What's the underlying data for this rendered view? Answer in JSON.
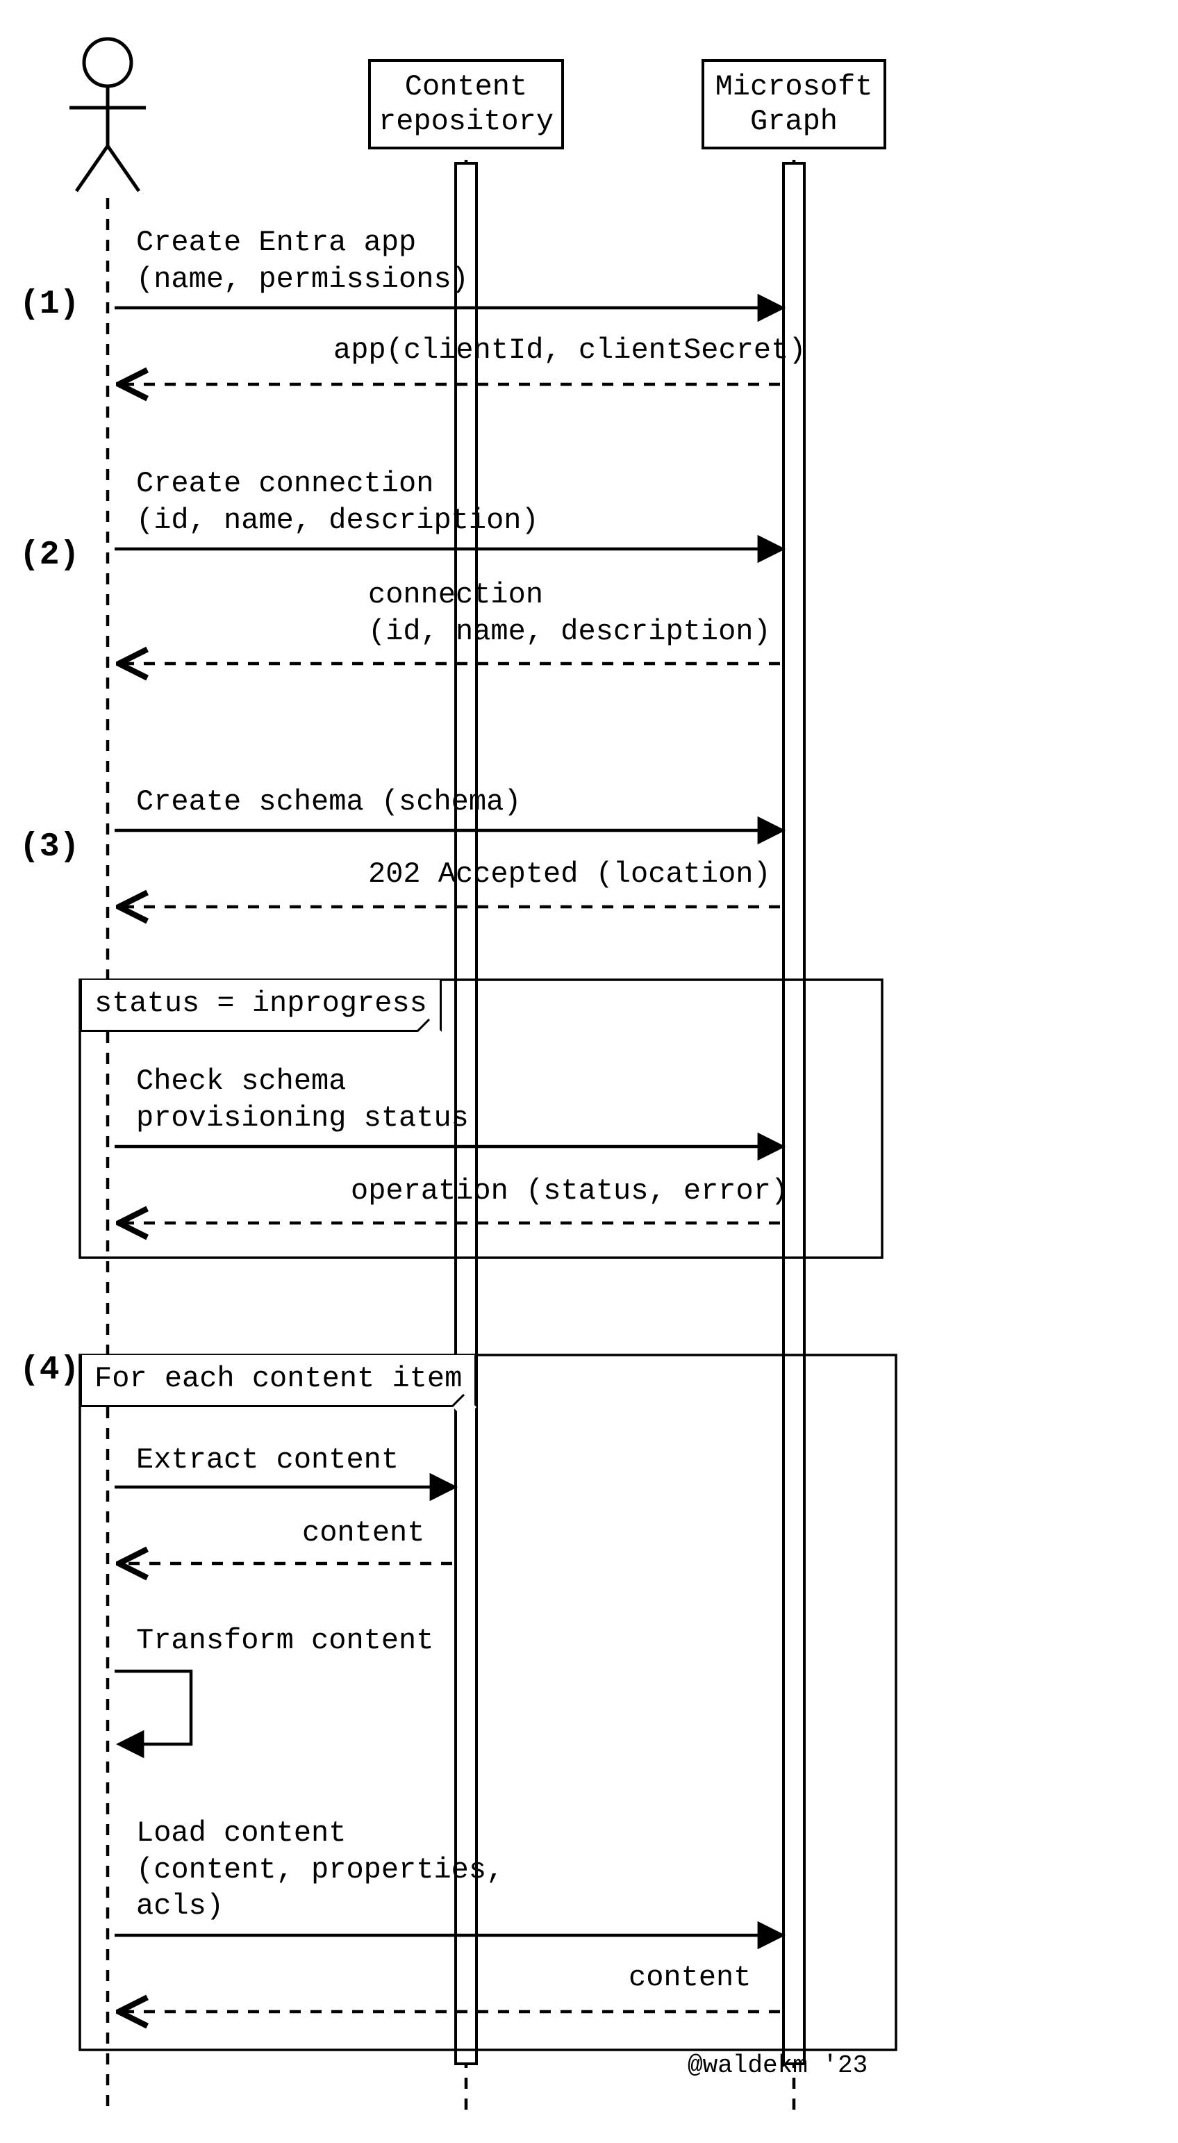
{
  "participants": {
    "actor": "Actor",
    "contentRepo": "Content\nrepository",
    "msGraph": "Microsoft\nGraph"
  },
  "steps": {
    "s1": "(1)",
    "s2": "(2)",
    "s3": "(3)",
    "s4": "(4)"
  },
  "messages": {
    "createEntraApp": "Create Entra app\n(name, permissions)",
    "appReturn": "app(clientId, clientSecret)",
    "createConnection": "Create connection\n(id, name, description)",
    "connectionReturn": "connection\n(id, name, description)",
    "createSchema": "Create schema (schema)",
    "acceptedReturn": "202 Accepted (location)",
    "checkStatus": "Check schema\nprovisioning status",
    "operationReturn": "operation (status, error)",
    "extractContent": "Extract content",
    "contentReturn1": "content",
    "transformContent": "Transform content",
    "loadContent": "Load content\n(content, properties,\nacls)",
    "contentReturn2": "content"
  },
  "loops": {
    "statusLoop": "status = inprogress",
    "contentLoop": "For each content item"
  },
  "credit": "@waldekm '23"
}
